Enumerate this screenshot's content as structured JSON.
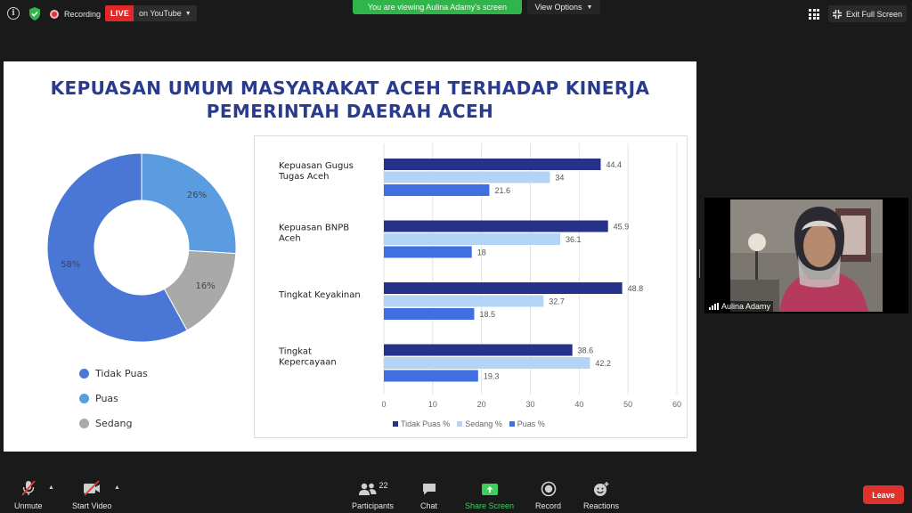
{
  "topbar": {
    "recording_label": "Recording",
    "live_label": "LIVE",
    "youtube_label": "on YouTube",
    "viewing_banner": "You are viewing Aulina Adamy's screen",
    "view_options_label": "View Options",
    "exit_fullscreen_label": "Exit Full Screen"
  },
  "slide": {
    "title_line1": "KEPUASAN UMUM MASYARAKAT ACEH TERHADAP KINERJA",
    "title_line2": "PEMERINTAH DAERAH ACEH",
    "title_color": "#2a3b8f"
  },
  "chart_data": [
    {
      "type": "pie",
      "donut": true,
      "title": "",
      "slices": [
        {
          "label": "Tidak Puas",
          "value": 58,
          "display": "58%",
          "color": "#4a77d6"
        },
        {
          "label": "Puas",
          "value": 26,
          "display": "26%",
          "color": "#5b9ce0"
        },
        {
          "label": "Sedang",
          "value": 16,
          "display": "16%",
          "color": "#a9a9a9"
        }
      ],
      "legend": [
        "Tidak Puas",
        "Puas",
        "Sedang"
      ],
      "legend_position": "bottom"
    },
    {
      "type": "bar",
      "orientation": "horizontal",
      "title": "",
      "categories": [
        "Kepuasan Gugus Tugas Aceh",
        "Kepuasan BNPB Aceh",
        "Tingkat Keyakinan",
        "Tingkat Kepercayaan"
      ],
      "category_lines": [
        [
          "Kepuasan Gugus",
          "Tugas Aceh"
        ],
        [
          "Kepuasan BNPB",
          "Aceh"
        ],
        [
          "Tingkat Keyakinan"
        ],
        [
          "Tingkat",
          "Kepercayaan"
        ]
      ],
      "series": [
        {
          "name": "Tidak Puas %",
          "values": [
            44.4,
            45.9,
            48.8,
            38.6
          ],
          "color": "#26318a"
        },
        {
          "name": "Sedang %",
          "values": [
            34,
            36.1,
            32.7,
            42.2
          ],
          "color": "#b3d4f5"
        },
        {
          "name": "Puas %",
          "values": [
            21.6,
            18,
            18.5,
            19.3
          ],
          "color": "#3f6fe0"
        }
      ],
      "value_labels": [
        [
          "44.4",
          "34",
          "21.6"
        ],
        [
          "45.9",
          "36.1",
          "18"
        ],
        [
          "48.8",
          "32.7",
          "18.5"
        ],
        [
          "38.6",
          "42.2",
          "19.3"
        ]
      ],
      "xlim": [
        0,
        60
      ],
      "xticks": [
        "0",
        "10",
        "20",
        "30",
        "40",
        "50",
        "60"
      ],
      "grid": true,
      "legend_position": "bottom"
    }
  ],
  "participant": {
    "name": "Aulina Adamy"
  },
  "toolbar": {
    "unmute_label": "Unmute",
    "start_video_label": "Start Video",
    "participants_label": "Participants",
    "participants_count": "22",
    "chat_label": "Chat",
    "share_screen_label": "Share Screen",
    "record_label": "Record",
    "reactions_label": "Reactions",
    "leave_label": "Leave",
    "share_color": "#3dcf5b",
    "leave_color": "#e0322c"
  }
}
